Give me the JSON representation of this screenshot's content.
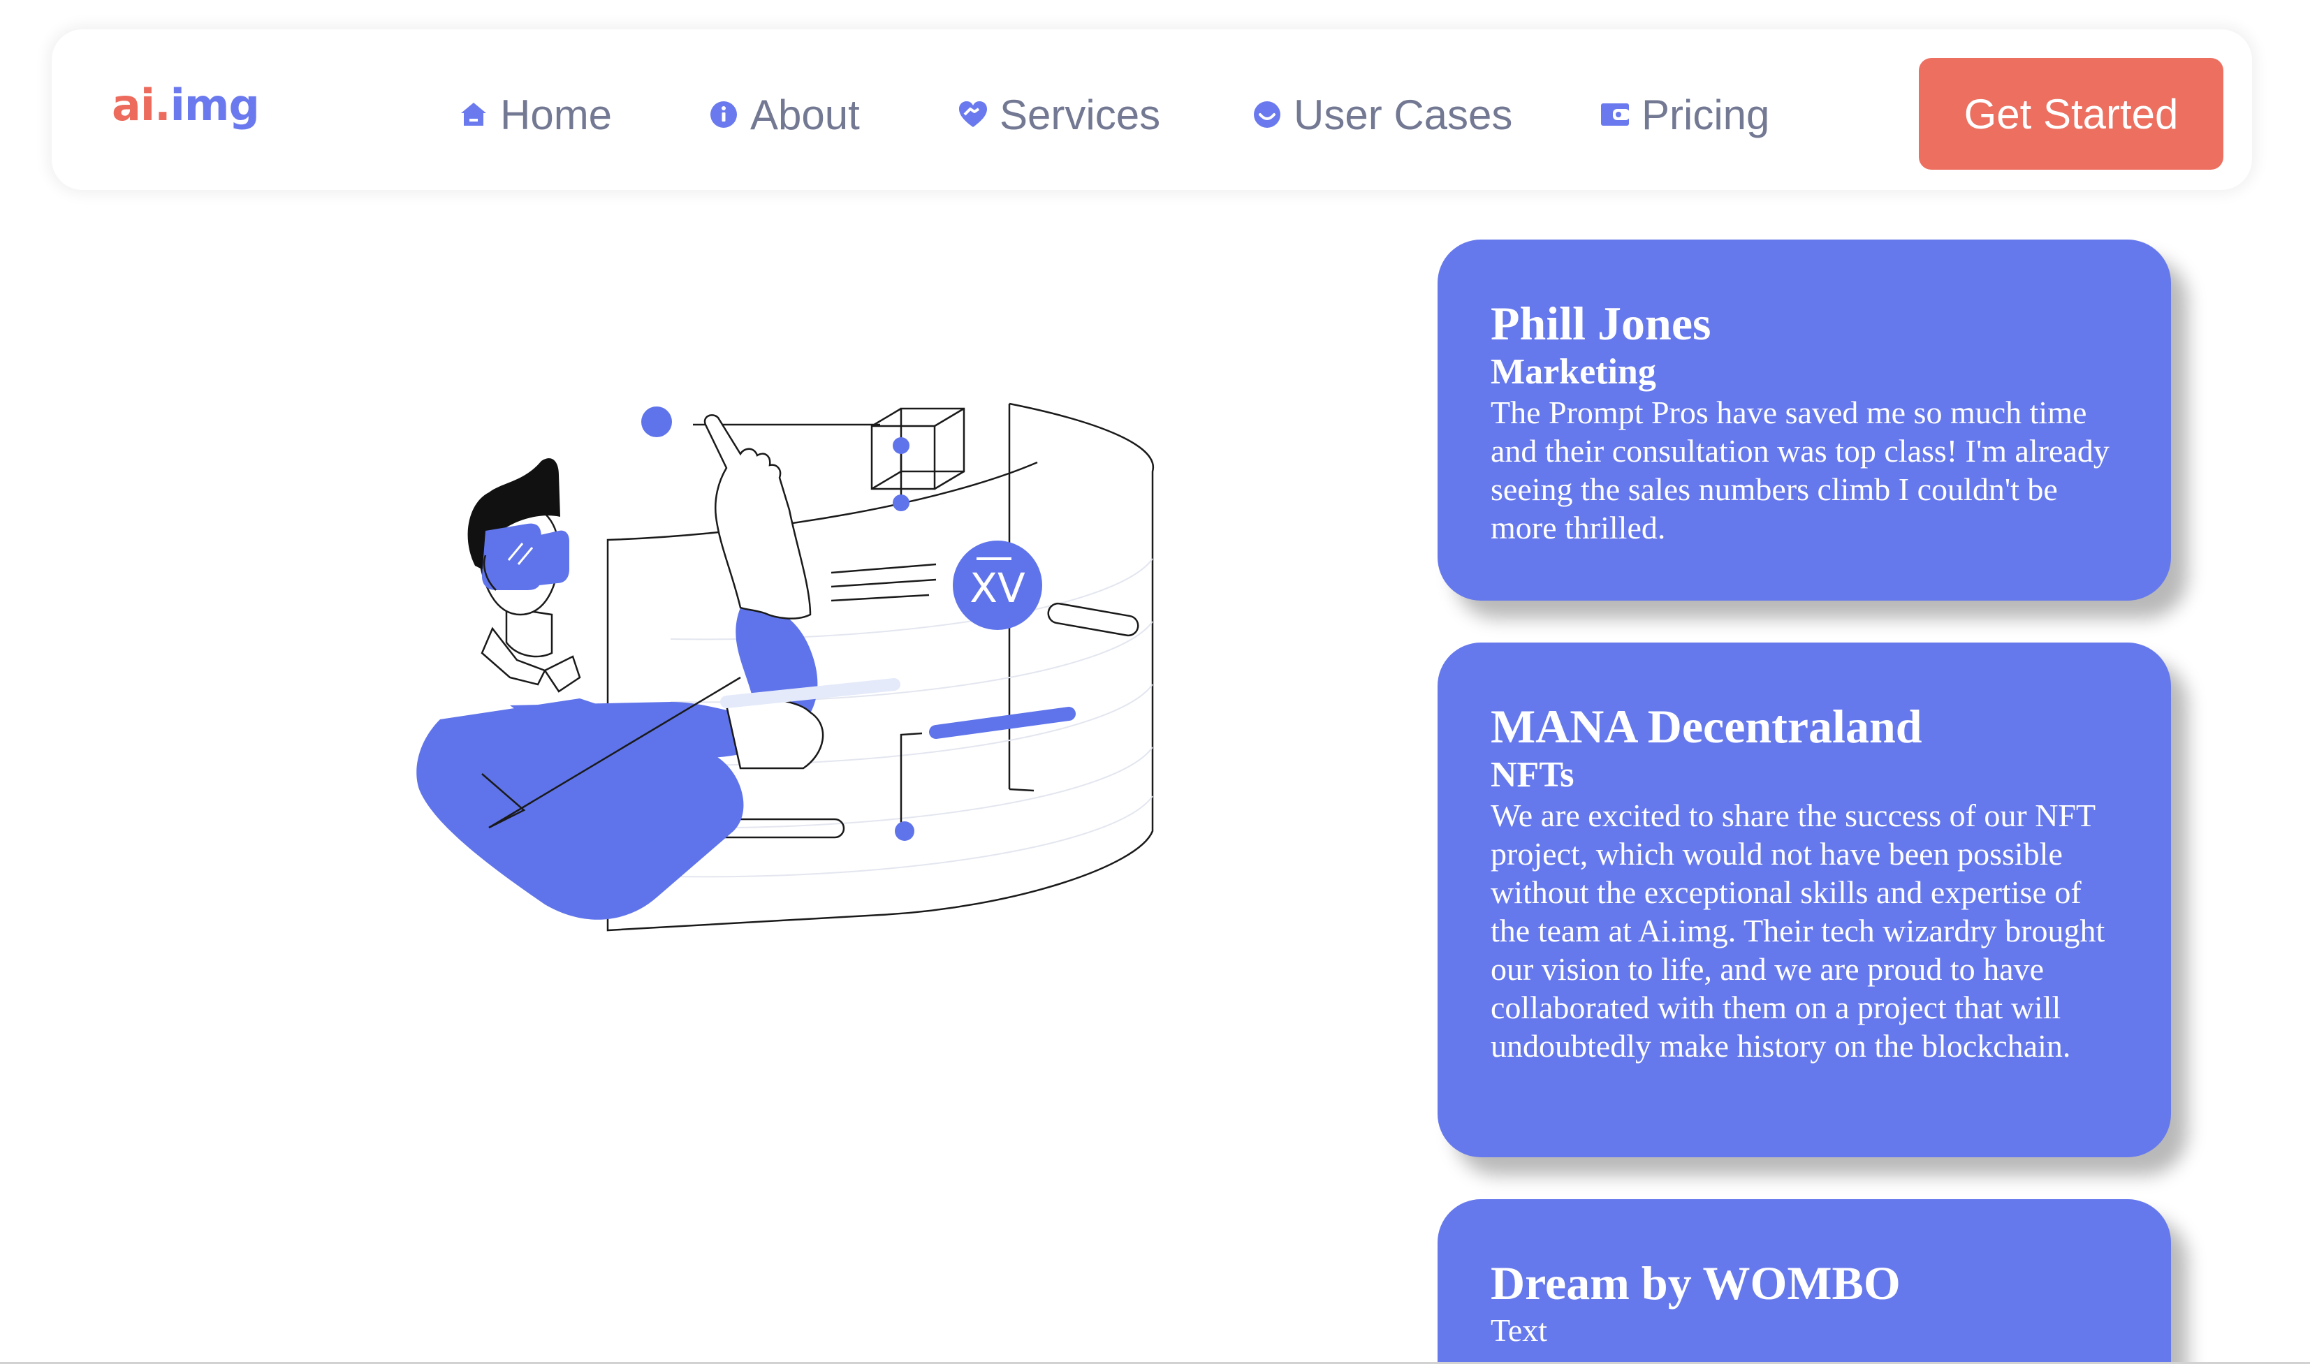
{
  "brand": {
    "logo_part1": "ai.",
    "logo_part2": "img",
    "colors": {
      "accent": "#6679ec",
      "cta": "#ec6f60",
      "nav_text": "#737893"
    }
  },
  "nav": {
    "items": [
      {
        "label": "Home",
        "icon": "home-icon"
      },
      {
        "label": "About",
        "icon": "info-icon"
      },
      {
        "label": "Services",
        "icon": "handshake-heart-icon"
      },
      {
        "label": "User Cases",
        "icon": "smile-icon"
      },
      {
        "label": "Pricing",
        "icon": "wallet-icon"
      }
    ],
    "cta_label": "Get Started"
  },
  "hero": {
    "illustration": "vr-user-touching-holographic-screen-illustration",
    "screen_symbol": "XV"
  },
  "testimonials": [
    {
      "name": "Phill Jones",
      "role": "Marketing",
      "text": "The Prompt Pros have saved me so much time and their consultation was top class! I'm already seeing the sales numbers climb I couldn't be more thrilled."
    },
    {
      "name": "MANA Decentraland",
      "role": "NFTs",
      "text": "We are excited to share the success of our NFT project, which would not have been possible without the exceptional skills and expertise of the team at Ai.img. Their tech wizardry brought our vision to life, and we are proud to have collaborated with them on a project that will undoubtedly make history on the blockchain."
    },
    {
      "name": "Dream by WOMBO",
      "role": "Text"
    }
  ]
}
